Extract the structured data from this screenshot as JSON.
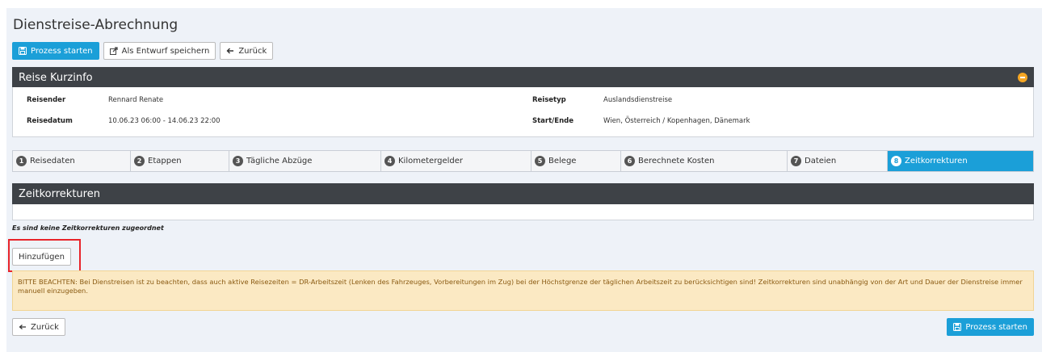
{
  "page": {
    "title": "Dienstreise-Abrechnung"
  },
  "toolbar": {
    "start_label": "Prozess starten",
    "draft_label": "Als Entwurf speichern",
    "back_label": "Zurück"
  },
  "info": {
    "heading": "Reise Kurzinfo",
    "rows": [
      {
        "label": "Reisender",
        "value": "Rennard Renate"
      },
      {
        "label": "Reisedatum",
        "value": "10.06.23 06:00 - 14.06.23 22:00"
      },
      {
        "label": "Reisetyp",
        "value": "Auslandsdienstreise"
      },
      {
        "label": "Start/Ende",
        "value": "Wien, Österreich / Kopenhagen, Dänemark"
      }
    ]
  },
  "tabs": [
    {
      "num": "1",
      "label": "Reisedaten"
    },
    {
      "num": "2",
      "label": "Etappen"
    },
    {
      "num": "3",
      "label": "Tägliche Abzüge"
    },
    {
      "num": "4",
      "label": "Kilometergelder"
    },
    {
      "num": "5",
      "label": "Belege"
    },
    {
      "num": "6",
      "label": "Berechnete Kosten"
    },
    {
      "num": "7",
      "label": "Dateien"
    },
    {
      "num": "8",
      "label": "Zeitkorrekturen"
    }
  ],
  "zeitkorrekturen": {
    "heading": "Zeitkorrekturen",
    "empty_message": "Es sind keine Zeitkorrekturen zugeordnet",
    "add_label": "Hinzufügen",
    "note": "BITTE BEACHTEN: Bei Dienstreisen ist zu beachten, dass auch aktive Reisezeiten = DR-Arbeitszeit (Lenken des Fahrzeuges, Vorbereitungen im Zug) bei der Höchstgrenze der täglichen Arbeitszeit zu berücksichtigen sind! Zeitkorrekturen sind unabhängig von der Art und Dauer der Dienstreise immer manuell einzugeben."
  },
  "footer": {
    "back_label": "Zurück",
    "start_label": "Prozess starten"
  },
  "colors": {
    "accent": "#1b9fd8",
    "header": "#3e4247",
    "warning_bg": "#fbe9c3",
    "highlight": "#e8242a"
  }
}
